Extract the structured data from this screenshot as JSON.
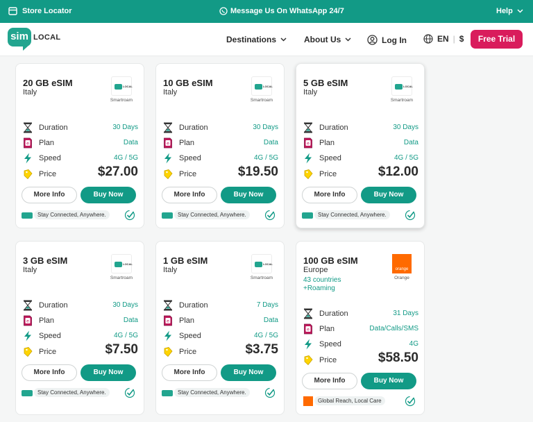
{
  "topbar": {
    "store_locator": "Store Locator",
    "whatsapp": "Message Us On WhatsApp 24/7",
    "help": "Help"
  },
  "nav": {
    "logo_mark": "sim",
    "logo_word": "LOCAL",
    "destinations": "Destinations",
    "about": "About Us",
    "login": "Log In",
    "language": "EN",
    "currency": "$",
    "free_trial": "Free Trial"
  },
  "labels": {
    "duration": "Duration",
    "plan": "Plan",
    "speed": "Speed",
    "price": "Price",
    "more_info": "More Info",
    "buy_now": "Buy Now"
  },
  "colors": {
    "brand_green": "#129a86",
    "trial_pink": "#d91c5c",
    "orange": "#ff6a00"
  },
  "cards": [
    {
      "title": "20 GB eSIM",
      "region": "Italy",
      "extra1": "",
      "extra2": "",
      "provider": "Smartroam",
      "provider_logo": "simlocal",
      "duration": "30 Days",
      "plan": "Data",
      "speed": "4G / 5G",
      "price": "$27.00",
      "footer": "Stay Connected, Anywhere."
    },
    {
      "title": "10 GB eSIM",
      "region": "Italy",
      "extra1": "",
      "extra2": "",
      "provider": "Smartroam",
      "provider_logo": "simlocal",
      "duration": "30 Days",
      "plan": "Data",
      "speed": "4G / 5G",
      "price": "$19.50",
      "footer": "Stay Connected, Anywhere."
    },
    {
      "title": "5 GB eSIM",
      "region": "Italy",
      "extra1": "",
      "extra2": "",
      "provider": "Smartroam",
      "provider_logo": "simlocal",
      "duration": "30 Days",
      "plan": "Data",
      "speed": "4G / 5G",
      "price": "$12.00",
      "footer": "Stay Connected, Anywhere."
    },
    {
      "title": "3 GB eSIM",
      "region": "Italy",
      "extra1": "",
      "extra2": "",
      "provider": "Smartroam",
      "provider_logo": "simlocal",
      "duration": "30 Days",
      "plan": "Data",
      "speed": "4G / 5G",
      "price": "$7.50",
      "footer": "Stay Connected, Anywhere."
    },
    {
      "title": "1 GB eSIM",
      "region": "Italy",
      "extra1": "",
      "extra2": "",
      "provider": "Smartroam",
      "provider_logo": "simlocal",
      "duration": "7 Days",
      "plan": "Data",
      "speed": "4G / 5G",
      "price": "$3.75",
      "footer": "Stay Connected, Anywhere."
    },
    {
      "title": "100 GB eSIM",
      "region": "Europe",
      "extra1": "43 countries",
      "extra2": "+Roaming",
      "provider": "Orange",
      "provider_logo": "orange",
      "provider_logo_text": "orange",
      "duration": "31 Days",
      "plan": "Data/Calls/SMS",
      "speed": "4G",
      "price": "$58.50",
      "footer": "Global Reach, Local Care"
    }
  ]
}
